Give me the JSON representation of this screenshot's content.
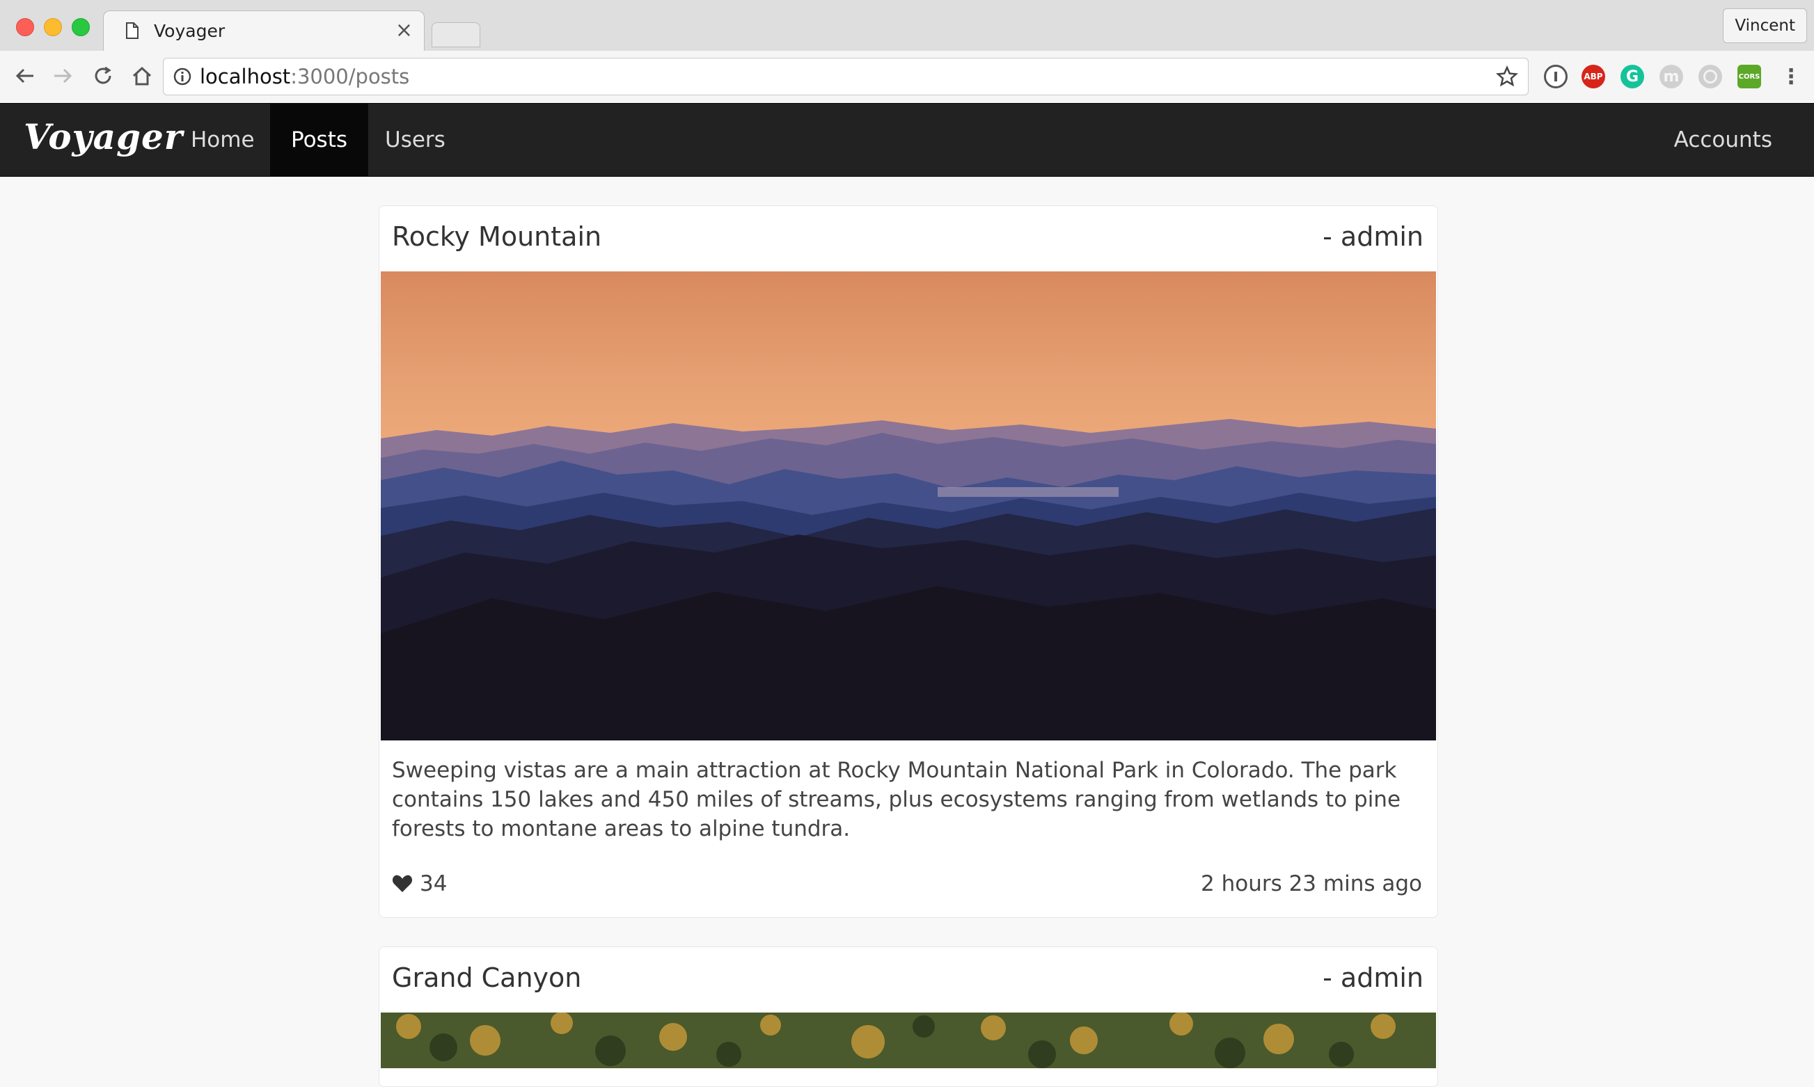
{
  "browser": {
    "tab_title": "Voyager",
    "tab_close": "×",
    "profile_name": "Vincent",
    "url_host": "localhost",
    "url_path": ":3000/posts",
    "extensions": {
      "abp": "ABP",
      "grammarly": "G",
      "m": "m",
      "cors": "CORS"
    }
  },
  "app": {
    "brand": "Voyager",
    "nav": {
      "home": "Home",
      "posts": "Posts",
      "users": "Users",
      "accounts": "Accounts"
    }
  },
  "posts": [
    {
      "title": "Rocky Mountain",
      "author": "- admin",
      "body": "Sweeping vistas are a main attraction at Rocky Mountain National Park in Colorado. The park contains 150 lakes and 450 miles of streams, plus ecosystems ranging from wetlands to pine forests to montane areas to alpine tundra.",
      "likes": "34",
      "time": "2 hours 23 mins ago"
    },
    {
      "title": "Grand Canyon",
      "author": "- admin"
    }
  ],
  "colors": {
    "navbar_bg": "#222222",
    "navbar_active": "#080808",
    "page_bg": "#f8f8f8"
  }
}
